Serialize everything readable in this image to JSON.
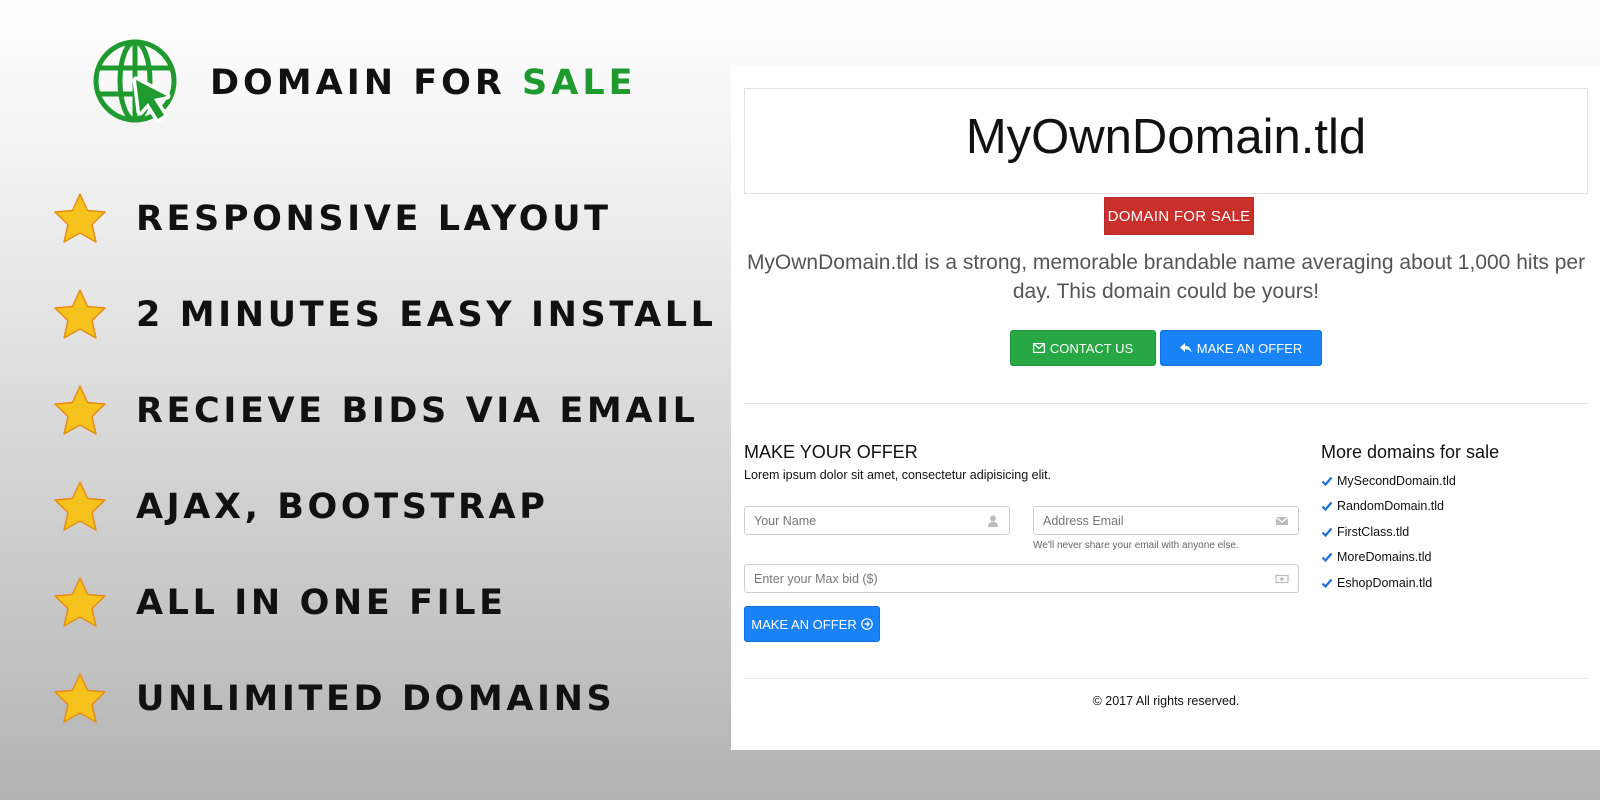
{
  "brand": {
    "logo_icon": "globe-cursor-icon",
    "title_main": "DOMAIN FOR ",
    "title_accent": "SALE",
    "accent_color": "#1e9a2e"
  },
  "features": [
    {
      "icon": "star-icon",
      "label": "RESPONSIVE LAYOUT"
    },
    {
      "icon": "star-icon",
      "label": "2 MINUTES EASY INSTALL"
    },
    {
      "icon": "star-icon",
      "label": "RECIEVE BIDS VIA EMAIL"
    },
    {
      "icon": "star-icon",
      "label": "AJAX, BOOTSTRAP"
    },
    {
      "icon": "star-icon",
      "label": "ALL IN ONE FILE"
    },
    {
      "icon": "star-icon",
      "label": "UNLIMITED DOMAINS"
    }
  ],
  "preview": {
    "domain_title": "MyOwnDomain.tld",
    "sale_badge": "DOMAIN FOR SALE",
    "description": "MyOwnDomain.tld is a strong, memorable brandable name averaging about 1,000 hits per day. This domain could be yours!",
    "buttons": {
      "contact": "CONTACT US",
      "offer": "MAKE AN OFFER"
    },
    "offer_form": {
      "title": "MAKE YOUR OFFER",
      "subtitle": "Lorem ipsum dolor sit amet, consectetur adipisicing elit.",
      "name_placeholder": "Your Name",
      "email_placeholder": "Address Email",
      "email_help": "We'll never share your email with anyone else.",
      "bid_placeholder": "Enter your Max bid ($)",
      "submit_label": "MAKE AN OFFER"
    },
    "more_domains": {
      "title": "More domains for sale",
      "items": [
        "MySecondDomain.tld",
        "RandomDomain.tld",
        "FirstClass.tld",
        "MoreDomains.tld",
        "EshopDomain.tld"
      ]
    },
    "footer": "© 2017 All rights reserved.",
    "colors": {
      "danger": "#c9302c",
      "success": "#28a745",
      "primary": "#1a82f7",
      "check": "#1a6fd8"
    }
  }
}
